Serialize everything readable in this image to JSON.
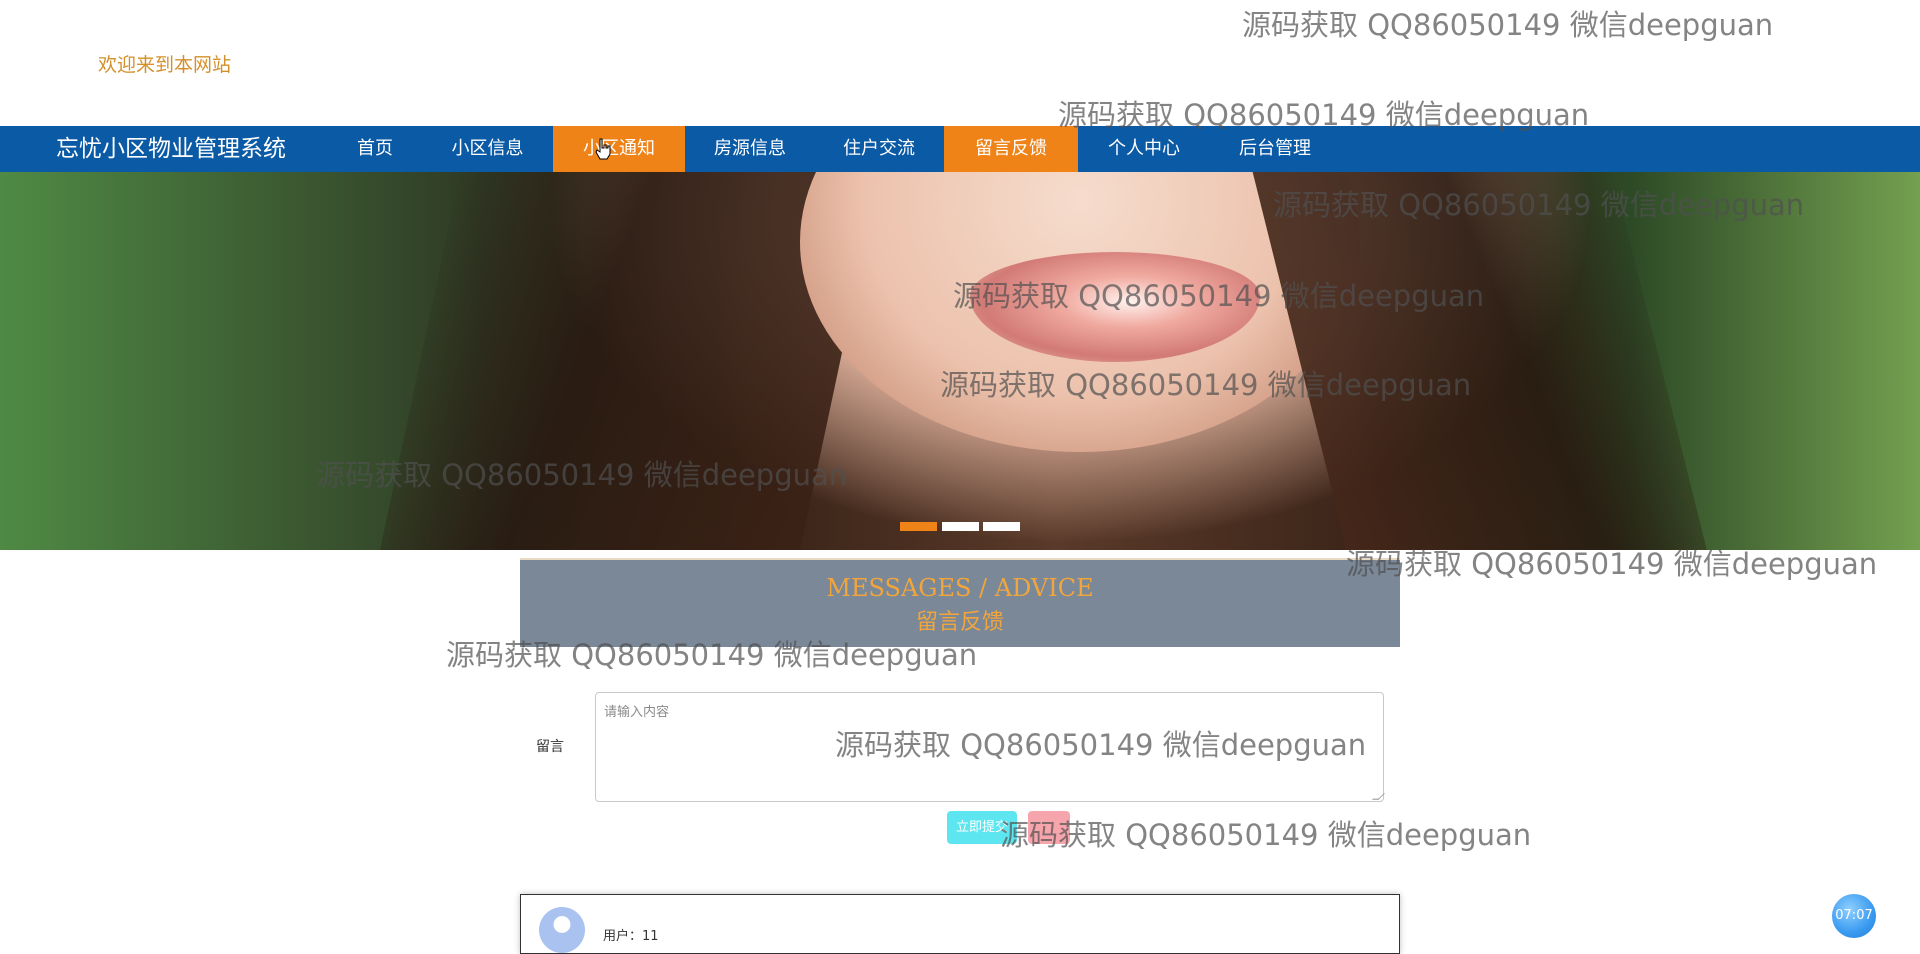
{
  "header": {
    "welcome_text": "欢迎来到本网站"
  },
  "navbar": {
    "brand": "忘忧小区物业管理系统",
    "items": [
      {
        "label": "首页",
        "active": false
      },
      {
        "label": "小区信息",
        "active": false
      },
      {
        "label": "小区通知",
        "active": true
      },
      {
        "label": "房源信息",
        "active": false
      },
      {
        "label": "住户交流",
        "active": false
      },
      {
        "label": "留言反馈",
        "active": true
      },
      {
        "label": "个人中心",
        "active": false
      },
      {
        "label": "后台管理",
        "active": false
      }
    ]
  },
  "carousel": {
    "slide_count": 3,
    "active_index": 0
  },
  "section": {
    "title_en": "MESSAGES / ADVICE",
    "title_cn": "留言反馈"
  },
  "form": {
    "label": "留言",
    "placeholder": "请输入内容",
    "value": "",
    "submit_label": "立即提交"
  },
  "comment": {
    "user_text": "用户：11"
  },
  "time_badge": "07:07",
  "watermark_text": "源码获取 QQ86050149 微信deepguan",
  "colors": {
    "nav_bg": "#0b5aa6",
    "nav_active": "#ef8318",
    "accent_orange": "#f2a53a",
    "welcome": "#d4902a",
    "banner_bg": "#7a8898",
    "submit_btn": "#5ee6f0",
    "reset_btn": "#f6a5ad"
  }
}
